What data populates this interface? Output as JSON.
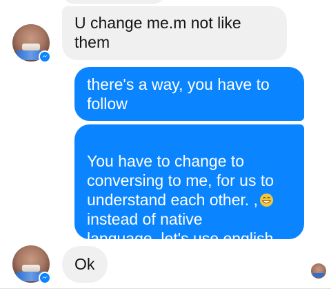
{
  "messages": [
    {
      "id": "m0",
      "direction": "incoming",
      "text": ""
    },
    {
      "id": "m1",
      "direction": "incoming",
      "text": "U change me.m not like\nthem"
    },
    {
      "id": "m2",
      "direction": "outgoing",
      "text": "there's a way, you have to\nfollow"
    },
    {
      "id": "m3",
      "direction": "outgoing",
      "text_before_emoji": "You have to change to\nconversing to me, for us to\nunderstand each other. ,",
      "emoji": "grinning-sweat-emoji",
      "text_after_emoji": "\ninstead of native\nlanguage ,let's use english"
    },
    {
      "id": "m4",
      "direction": "incoming",
      "text": "Ok"
    }
  ],
  "avatars": {
    "contact": {
      "icon": "contact-avatar",
      "badge_icon": "messenger-badge-icon"
    },
    "seen_indicator": {
      "icon": "seen-avatar-icon"
    }
  },
  "colors": {
    "outgoing_bubble": "#0a84ff",
    "incoming_bubble": "#f0f0f0",
    "incoming_text": "#141414",
    "outgoing_text": "#ffffff"
  }
}
